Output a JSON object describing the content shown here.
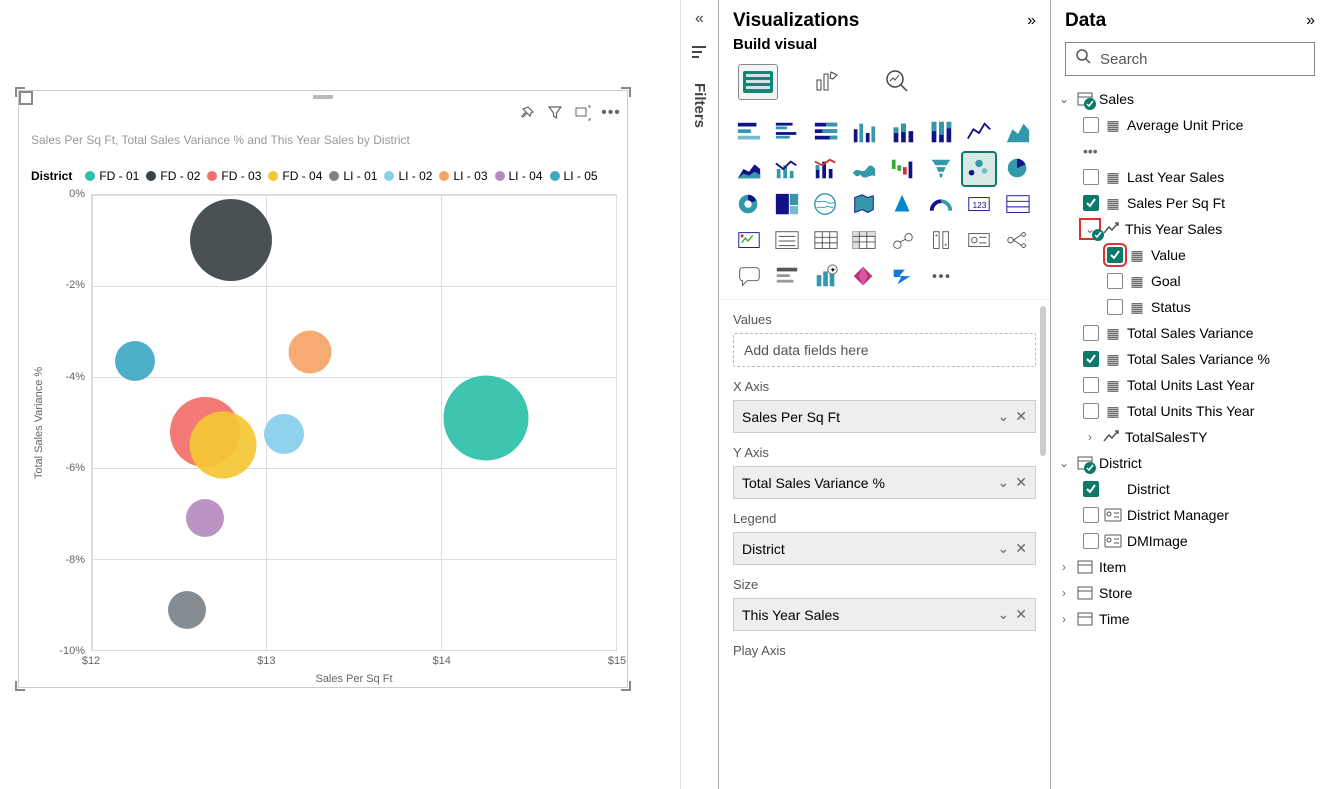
{
  "chart": {
    "title": "Sales Per Sq Ft, Total Sales Variance % and This Year Sales by District",
    "legend_title": "District",
    "x_axis_label": "Sales Per Sq Ft",
    "y_axis_label": "Total Sales Variance %",
    "x_ticks": [
      "$12",
      "$13",
      "$14",
      "$15"
    ],
    "y_ticks": [
      "0%",
      "-2%",
      "-4%",
      "-6%",
      "-8%",
      "-10%"
    ],
    "series": [
      {
        "name": "FD - 01",
        "color": "#2cc0a8"
      },
      {
        "name": "FD - 02",
        "color": "#3a4247"
      },
      {
        "name": "FD - 03",
        "color": "#f36f6a"
      },
      {
        "name": "FD - 04",
        "color": "#f4c733"
      },
      {
        "name": "LI - 01",
        "color": "#7b8389"
      },
      {
        "name": "LI - 02",
        "color": "#87ceeb"
      },
      {
        "name": "LI - 03",
        "color": "#f5a469"
      },
      {
        "name": "LI - 04",
        "color": "#b58bbf"
      },
      {
        "name": "LI - 05",
        "color": "#3ea8c3"
      }
    ]
  },
  "chart_data": {
    "type": "scatter",
    "title": "Sales Per Sq Ft, Total Sales Variance % and This Year Sales by District",
    "xlabel": "Sales Per Sq Ft",
    "ylabel": "Total Sales Variance %",
    "xlim": [
      12,
      15
    ],
    "ylim": [
      -10,
      0
    ],
    "size_field": "This Year Sales",
    "series": [
      {
        "name": "FD - 01",
        "x": 14.25,
        "y": -4.9,
        "size": 85,
        "color": "#2cc0a8"
      },
      {
        "name": "FD - 02",
        "x": 12.8,
        "y": -1.0,
        "size": 82,
        "color": "#3a4247"
      },
      {
        "name": "FD - 03",
        "x": 12.65,
        "y": -5.2,
        "size": 70,
        "color": "#f36f6a"
      },
      {
        "name": "FD - 04",
        "x": 12.75,
        "y": -5.5,
        "size": 67,
        "color": "#f4c733"
      },
      {
        "name": "LI - 01",
        "x": 12.55,
        "y": -9.1,
        "size": 38,
        "color": "#7b8389"
      },
      {
        "name": "LI - 02",
        "x": 13.1,
        "y": -5.25,
        "size": 40,
        "color": "#87ceeb"
      },
      {
        "name": "LI - 03",
        "x": 13.25,
        "y": -3.45,
        "size": 43,
        "color": "#f5a469"
      },
      {
        "name": "LI - 04",
        "x": 12.65,
        "y": -7.1,
        "size": 38,
        "color": "#b58bbf"
      },
      {
        "name": "LI - 05",
        "x": 12.25,
        "y": -3.65,
        "size": 40,
        "color": "#3ea8c3"
      }
    ]
  },
  "filters_rail": {
    "label": "Filters"
  },
  "viz_pane": {
    "title": "Visualizations",
    "subtitle": "Build visual",
    "wells": {
      "values_label": "Values",
      "values_placeholder": "Add data fields here",
      "x_label": "X Axis",
      "x_field": "Sales Per Sq Ft",
      "y_label": "Y Axis",
      "y_field": "Total Sales Variance %",
      "legend_label": "Legend",
      "legend_field": "District",
      "size_label": "Size",
      "size_field": "This Year Sales",
      "play_label": "Play Axis"
    }
  },
  "data_pane": {
    "title": "Data",
    "search_placeholder": "Search",
    "tables": {
      "sales": "Sales",
      "district": "District",
      "item": "Item",
      "store": "Store",
      "time": "Time"
    },
    "fields": {
      "avg_unit_price": "Average Unit Price",
      "last_year_sales": "Last Year Sales",
      "sales_per_sqft": "Sales Per Sq Ft",
      "this_year_sales": "This Year Sales",
      "tys_value": "Value",
      "tys_goal": "Goal",
      "tys_status": "Status",
      "total_sales_variance": "Total Sales Variance",
      "total_sales_variance_pct": "Total Sales Variance %",
      "total_units_last_year": "Total Units Last Year",
      "total_units_this_year": "Total Units This Year",
      "total_sales_ty": "TotalSalesTY",
      "district_field": "District",
      "district_manager": "District Manager",
      "dm_image": "DMImage"
    }
  }
}
